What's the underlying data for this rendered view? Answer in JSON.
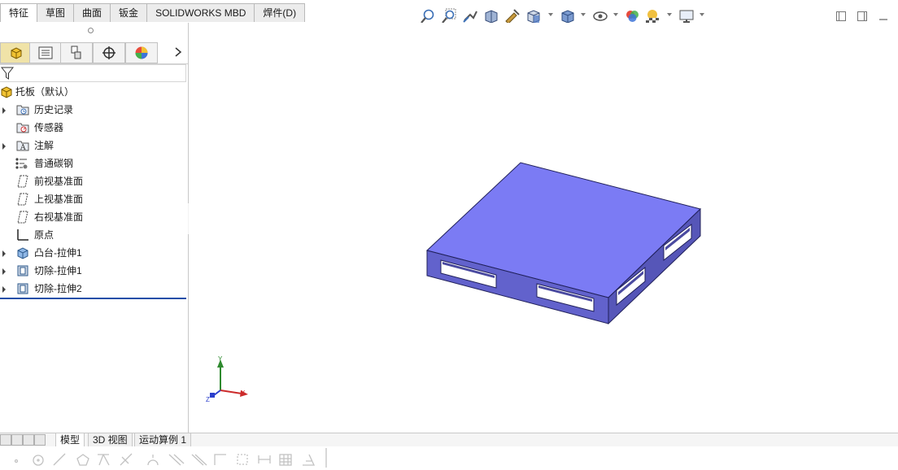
{
  "command_tabs": [
    "特征",
    "草图",
    "曲面",
    "钣金",
    "SOLIDWORKS MBD",
    "焊件(D)"
  ],
  "active_command_tab": 0,
  "heads_up_toolbar": [
    {
      "name": "zoom-to-fit-icon"
    },
    {
      "name": "zoom-to-area-icon"
    },
    {
      "name": "previous-view-icon"
    },
    {
      "name": "section-view-icon"
    },
    {
      "name": "dynamic-annotation-icon"
    },
    {
      "name": "view-orientation-icon"
    },
    {
      "name": "display-style-icon"
    },
    {
      "name": "hide-show-items-icon"
    },
    {
      "name": "edit-appearance-icon"
    },
    {
      "name": "apply-scene-icon"
    },
    {
      "name": "view-settings-icon"
    }
  ],
  "tree": {
    "root_label": "托板（默认）",
    "items": [
      {
        "label": "历史记录",
        "icon": "history-folder-icon",
        "expandable": true
      },
      {
        "label": "传感器",
        "icon": "sensor-folder-icon",
        "expandable": false
      },
      {
        "label": "注解",
        "icon": "annotation-folder-icon",
        "expandable": true
      },
      {
        "label": "普通碳钢",
        "icon": "material-icon",
        "expandable": false
      },
      {
        "label": "前视基准面",
        "icon": "plane-icon",
        "expandable": false
      },
      {
        "label": "上视基准面",
        "icon": "plane-icon",
        "expandable": false
      },
      {
        "label": "右视基准面",
        "icon": "plane-icon",
        "expandable": false
      },
      {
        "label": "原点",
        "icon": "origin-icon",
        "expandable": false
      },
      {
        "label": "凸台-拉伸1",
        "icon": "boss-extrude-icon",
        "expandable": true
      },
      {
        "label": "切除-拉伸1",
        "icon": "cut-extrude-icon",
        "expandable": true
      },
      {
        "label": "切除-拉伸2",
        "icon": "cut-extrude-icon",
        "expandable": true
      }
    ]
  },
  "bottom_tabs": [
    "模型",
    "3D 视图",
    "运动算例 1"
  ],
  "active_bottom_tab": 0,
  "triad": {
    "x": "X",
    "y": "Y",
    "z": "Z"
  },
  "colors": {
    "model_top": "#7b7bf4",
    "model_side": "#5656b8",
    "model_front": "#6262cc",
    "accent": "#1f4fa8"
  }
}
